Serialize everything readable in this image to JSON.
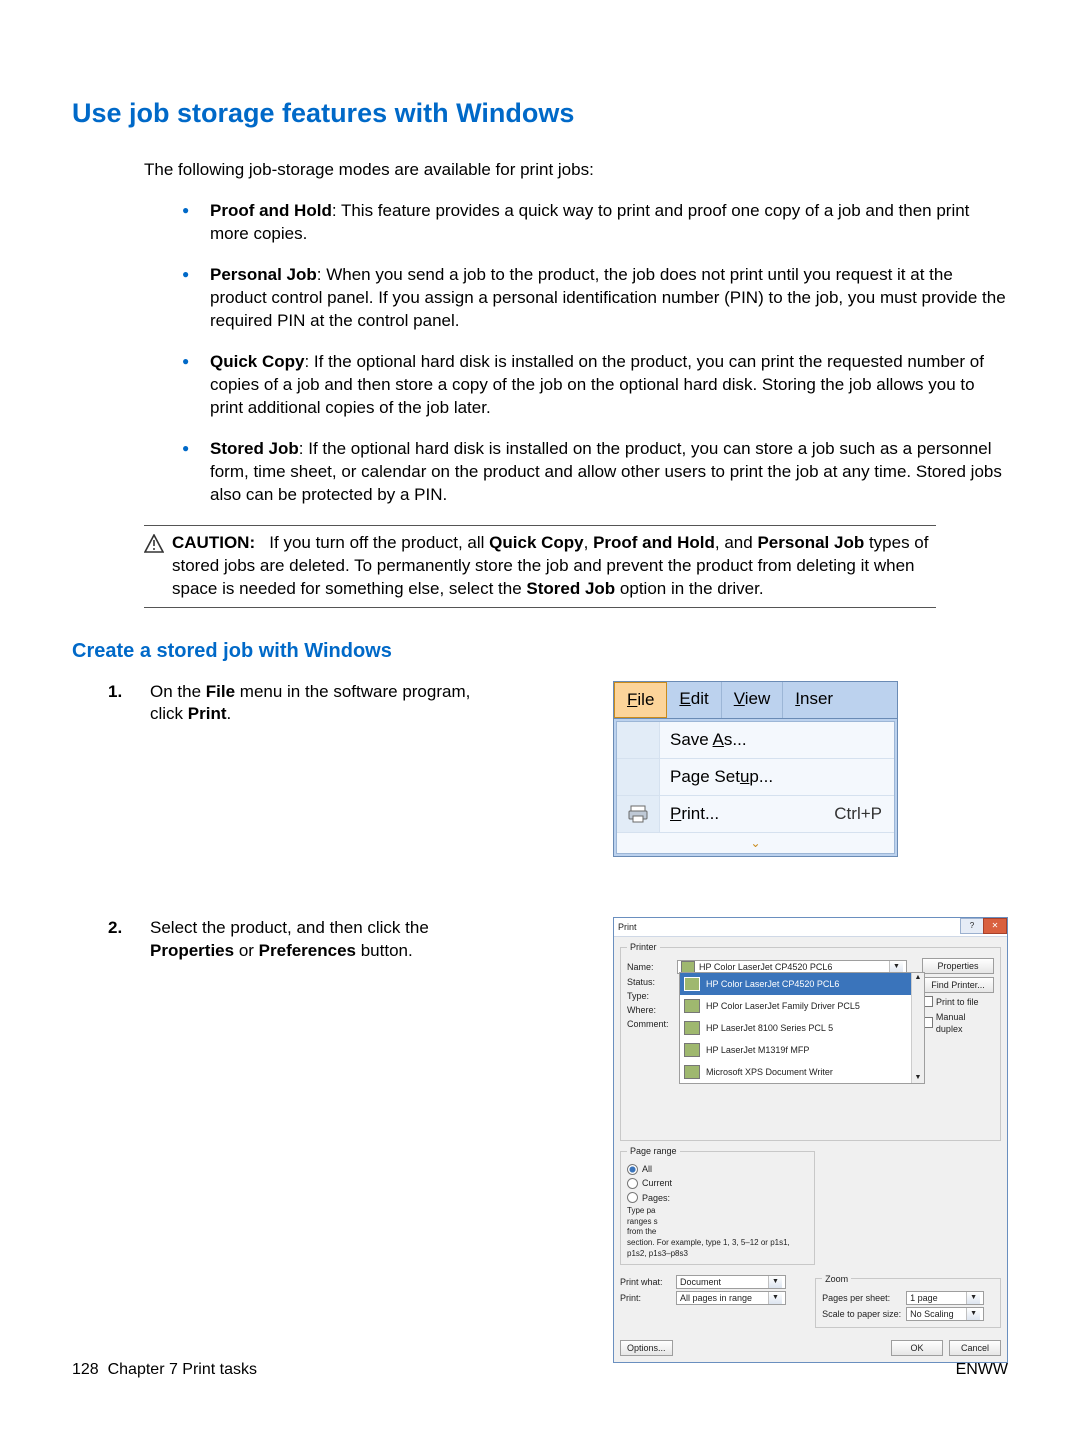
{
  "heading": "Use job storage features with Windows",
  "intro": "The following job-storage modes are available for print jobs:",
  "bullets": [
    {
      "term": "Proof and Hold",
      "text": ": This feature provides a quick way to print and proof one copy of a job and then print more copies."
    },
    {
      "term": "Personal Job",
      "text": ": When you send a job to the product, the job does not print until you request it at the product control panel. If you assign a personal identification number (PIN) to the job, you must provide the required PIN at the control panel."
    },
    {
      "term": "Quick Copy",
      "text": ": If the optional hard disk is installed on the product, you can print the requested number of copies of a job and then store a copy of the job on the optional hard disk. Storing the job allows you to print additional copies of the job later."
    },
    {
      "term": "Stored Job",
      "text": ": If the optional hard disk is installed on the product, you can store a job such as a personnel form, time sheet, or calendar on the product and allow other users to print the job at any time. Stored jobs also can be protected by a PIN."
    }
  ],
  "caution": {
    "label": "CAUTION:",
    "before": "If you turn off the product, all ",
    "b1": "Quick Copy",
    "sep1": ", ",
    "b2": "Proof and Hold",
    "sep2": ", and ",
    "b3": "Personal Job",
    "after1": " types of stored jobs are deleted. To permanently store the job and prevent the product from deleting it when space is needed for something else, select the ",
    "b4": "Stored Job",
    "after2": " option in the driver."
  },
  "subheading": "Create a stored job with Windows",
  "step1": {
    "num": "1.",
    "pre": "On the ",
    "b1": "File",
    "mid": " menu in the software program, click ",
    "b2": "Print",
    "post": "."
  },
  "step2": {
    "num": "2.",
    "pre": "Select the product, and then click the ",
    "b1": "Properties",
    "mid": " or ",
    "b2": "Preferences",
    "post": " button."
  },
  "fig1": {
    "menubar": {
      "file": "File",
      "edit": "Edit",
      "view": "View",
      "insert": "Inser"
    },
    "items": {
      "saveas": "Save As...",
      "pagesetup": "Page Setup...",
      "print": "Print...",
      "print_key": "Ctrl+P"
    }
  },
  "fig2": {
    "title": "Print",
    "printer_legend": "Printer",
    "labels": {
      "name": "Name:",
      "status": "Status:",
      "type": "Type:",
      "where": "Where:",
      "comment": "Comment:"
    },
    "selected_printer": "HP Color LaserJet CP4520 PCL6",
    "btn_properties": "Properties",
    "btn_find": "Find Printer...",
    "chk_printfile": "Print to file",
    "chk_manualduplex": "Manual duplex",
    "printer_list": [
      "HP Color LaserJet CP4520 PCL6",
      "HP Color LaserJet Family Driver PCL5",
      "HP LaserJet 8100 Series PCL 5",
      "HP LaserJet M1319f MFP",
      "Microsoft XPS Document Writer"
    ],
    "pagerange_legend": "Page range",
    "pagerange": {
      "all": "All",
      "current": "Current",
      "pages": "Pages:",
      "hint": "section. For example, type 1, 3, 5–12 or p1s1, p1s2, p1s3–p8s3",
      "hint_pre": "Type pa\nranges s\nfrom the"
    },
    "zoom_legend": "Zoom",
    "printwhat_lbl": "Print what:",
    "printwhat_val": "Document",
    "print_lbl": "Print:",
    "print_val": "All pages in range",
    "pps_lbl": "Pages per sheet:",
    "pps_val": "1 page",
    "scale_lbl": "Scale to paper size:",
    "scale_val": "No Scaling",
    "btn_options": "Options...",
    "btn_ok": "OK",
    "btn_cancel": "Cancel"
  },
  "footer": {
    "page_num": "128",
    "chapter": "Chapter 7   Print tasks",
    "right": "ENWW"
  }
}
